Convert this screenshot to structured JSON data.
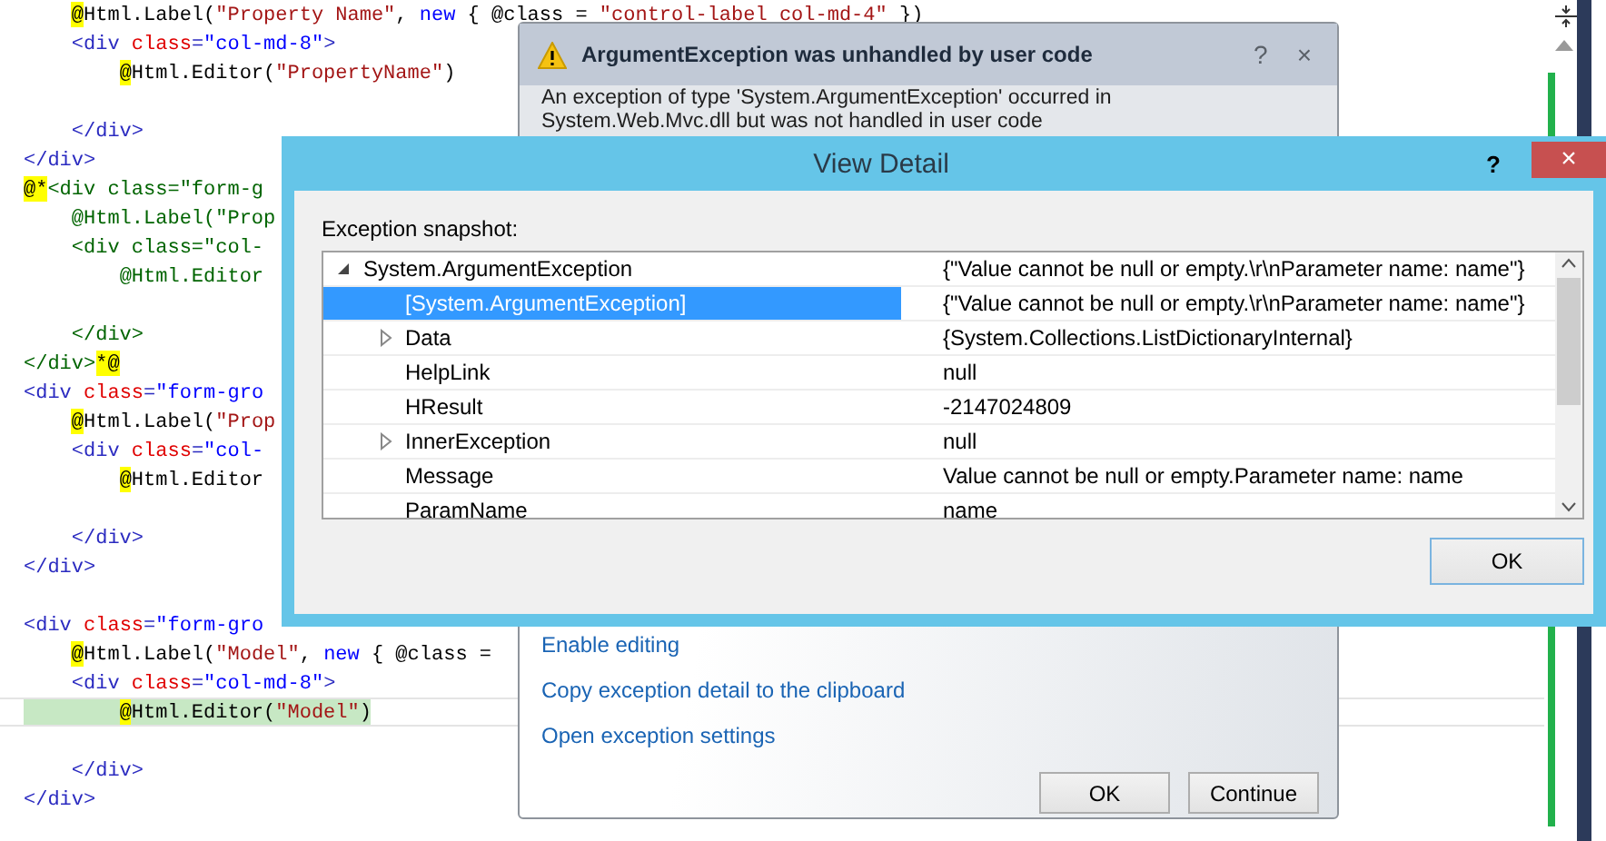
{
  "editor": {
    "lines": [
      {
        "kind": "code",
        "current": false,
        "tokens": [
          {
            "kind": "razor",
            "t": "    @"
          },
          {
            "kind": "text",
            "t": "Html.Label("
          },
          {
            "kind": "string",
            "t": "\"Property Name\""
          },
          {
            "kind": "text",
            "t": ", "
          },
          {
            "kind": "keyword",
            "t": "new"
          },
          {
            "kind": "text",
            "t": " { @class = "
          },
          {
            "kind": "string",
            "t": "\"control-label col-md-4\""
          },
          {
            "kind": "text",
            "t": " })"
          }
        ]
      },
      {
        "kind": "code",
        "current": false,
        "tokens": [
          {
            "kind": "tag",
            "t": "    <div "
          },
          {
            "kind": "attr",
            "t": "class"
          },
          {
            "kind": "tag",
            "t": "="
          },
          {
            "kind": "value",
            "t": "\"col-md-8\""
          },
          {
            "kind": "tag",
            "t": ">"
          }
        ]
      },
      {
        "kind": "code",
        "current": false,
        "tokens": [
          {
            "kind": "razor",
            "t": "        @"
          },
          {
            "kind": "text",
            "t": "Html.Editor("
          },
          {
            "kind": "string",
            "t": "\"PropertyName\""
          },
          {
            "kind": "text",
            "t": ")"
          }
        ]
      },
      {
        "kind": "blank"
      },
      {
        "kind": "code",
        "current": false,
        "tokens": [
          {
            "kind": "tag",
            "t": "    </div>"
          }
        ]
      },
      {
        "kind": "code",
        "current": false,
        "tokens": [
          {
            "kind": "tag",
            "t": "</div>"
          }
        ]
      },
      {
        "kind": "code",
        "current": false,
        "tokens": [
          {
            "kind": "razor",
            "t": "@*"
          },
          {
            "kind": "comment",
            "t": "<div class=\"form-g"
          }
        ]
      },
      {
        "kind": "code",
        "current": false,
        "tokens": [
          {
            "kind": "comment",
            "t": "    @Html.Label(\"Prop"
          }
        ]
      },
      {
        "kind": "code",
        "current": false,
        "tokens": [
          {
            "kind": "comment",
            "t": "    <div class=\"col-"
          }
        ]
      },
      {
        "kind": "code",
        "current": false,
        "tokens": [
          {
            "kind": "comment",
            "t": "        @Html.Editor"
          }
        ]
      },
      {
        "kind": "blank"
      },
      {
        "kind": "code",
        "current": false,
        "tokens": [
          {
            "kind": "comment",
            "t": "    </div>"
          }
        ]
      },
      {
        "kind": "code",
        "current": false,
        "tokens": [
          {
            "kind": "comment",
            "t": "</div>"
          },
          {
            "kind": "razor",
            "t": "*@"
          }
        ]
      },
      {
        "kind": "code",
        "current": false,
        "tokens": [
          {
            "kind": "tag",
            "t": "<div "
          },
          {
            "kind": "attr",
            "t": "class"
          },
          {
            "kind": "tag",
            "t": "="
          },
          {
            "kind": "value",
            "t": "\"form-gro"
          }
        ]
      },
      {
        "kind": "code",
        "current": false,
        "tokens": [
          {
            "kind": "razor",
            "t": "    @"
          },
          {
            "kind": "text",
            "t": "Html.Label("
          },
          {
            "kind": "string",
            "t": "\"Prop"
          }
        ]
      },
      {
        "kind": "code",
        "current": false,
        "tokens": [
          {
            "kind": "tag",
            "t": "    <div "
          },
          {
            "kind": "attr",
            "t": "class"
          },
          {
            "kind": "tag",
            "t": "="
          },
          {
            "kind": "value",
            "t": "\"col-"
          }
        ]
      },
      {
        "kind": "code",
        "current": false,
        "tokens": [
          {
            "kind": "razor",
            "t": "        @"
          },
          {
            "kind": "text",
            "t": "Html.Editor"
          }
        ]
      },
      {
        "kind": "blank"
      },
      {
        "kind": "code",
        "current": false,
        "tokens": [
          {
            "kind": "tag",
            "t": "    </div>"
          }
        ]
      },
      {
        "kind": "code",
        "current": false,
        "tokens": [
          {
            "kind": "tag",
            "t": "</div>"
          }
        ]
      },
      {
        "kind": "blank"
      },
      {
        "kind": "code",
        "current": false,
        "tokens": [
          {
            "kind": "tag",
            "t": "<div "
          },
          {
            "kind": "attr",
            "t": "class"
          },
          {
            "kind": "tag",
            "t": "="
          },
          {
            "kind": "value",
            "t": "\"form-gro"
          }
        ]
      },
      {
        "kind": "code",
        "current": false,
        "tokens": [
          {
            "kind": "razor",
            "t": "    @"
          },
          {
            "kind": "text",
            "t": "Html.Label("
          },
          {
            "kind": "string",
            "t": "\"Model\""
          },
          {
            "kind": "text",
            "t": ", "
          },
          {
            "kind": "keyword",
            "t": "new"
          },
          {
            "kind": "text",
            "t": " { @class ="
          }
        ]
      },
      {
        "kind": "code",
        "current": false,
        "tokens": [
          {
            "kind": "tag",
            "t": "    <div "
          },
          {
            "kind": "attr",
            "t": "class"
          },
          {
            "kind": "tag",
            "t": "="
          },
          {
            "kind": "value",
            "t": "\"col-md-8\""
          },
          {
            "kind": "tag",
            "t": ">"
          }
        ]
      },
      {
        "kind": "code",
        "current": true,
        "tokens": [
          {
            "kind": "razor",
            "t": "        @"
          },
          {
            "kind": "text",
            "t": "Html.Editor("
          },
          {
            "kind": "string",
            "t": "\"Model\""
          },
          {
            "kind": "text",
            "t": ")"
          }
        ]
      },
      {
        "kind": "blank"
      },
      {
        "kind": "code",
        "current": false,
        "tokens": [
          {
            "kind": "tag",
            "t": "    </div>"
          }
        ]
      },
      {
        "kind": "code",
        "current": false,
        "tokens": [
          {
            "kind": "tag",
            "t": "</div>"
          }
        ]
      }
    ]
  },
  "exception_popup": {
    "title": "ArgumentException was unhandled by user code",
    "help": "?",
    "close": "×",
    "message": "An exception of type 'System.ArgumentException' occurred in System.Web.Mvc.dll but was not handled in user code",
    "links": [
      "Enable editing",
      "Copy exception detail to the clipboard",
      "Open exception settings"
    ],
    "buttons": [
      "OK",
      "Continue"
    ]
  },
  "view_detail": {
    "title": "View Detail",
    "help": "?",
    "close": "×",
    "label": "Exception snapshot:",
    "rows": [
      {
        "name": "System.ArgumentException",
        "value": "{\"Value cannot be null or empty.\\r\\nParameter name: name\"}",
        "expanded": true,
        "selected": false,
        "children": [
          {
            "name": "[System.ArgumentException]",
            "value": "{\"Value cannot be null or empty.\\r\\nParameter name: name\"}",
            "selected": true
          },
          {
            "name": "Data",
            "value": "{System.Collections.ListDictionaryInternal}",
            "expanded": false,
            "selected": false
          },
          {
            "name": "HelpLink",
            "value": "null",
            "selected": false
          },
          {
            "name": "HResult",
            "value": "-2147024809",
            "selected": false
          },
          {
            "name": "InnerException",
            "value": "null",
            "expanded": false,
            "selected": false
          },
          {
            "name": "Message",
            "value": "Value cannot be null or empty.Parameter name: name",
            "selected": false
          },
          {
            "name": "ParamName",
            "value": "name",
            "selected": false
          }
        ]
      }
    ],
    "ok": "OK"
  }
}
